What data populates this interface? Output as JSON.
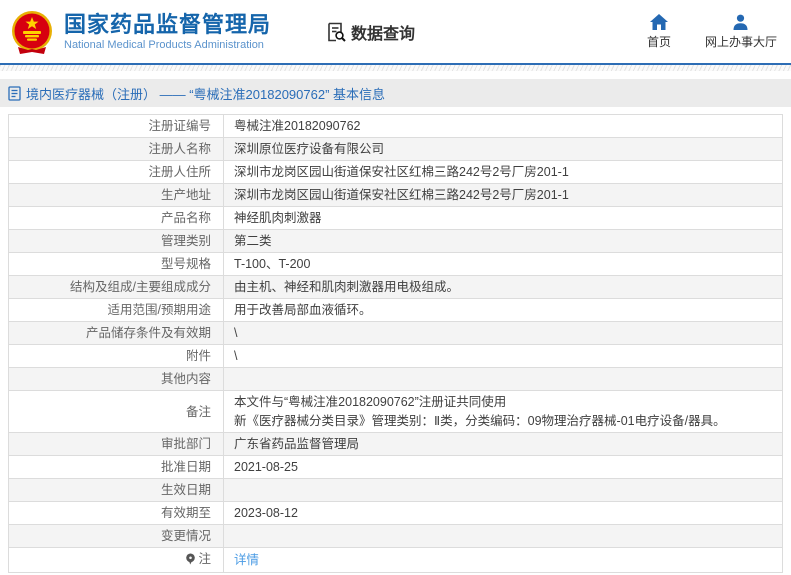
{
  "header": {
    "title": "国家药品监督管理局",
    "subtitle": "National Medical Products Administration",
    "nav_query_label": "数据查询",
    "nav_home_label": "首页",
    "nav_hall_label": "网上办事大厅"
  },
  "breadcrumb": {
    "text": "境内医疗器械（注册） —— “粤械注准20182090762” 基本信息"
  },
  "colors": {
    "brand_blue": "#1565ab",
    "accent_blue": "#2d6db5",
    "link_blue": "#4a9be4",
    "row_alt_gray": "#f4f4f4"
  },
  "table": {
    "rows": [
      {
        "label": "注册证编号",
        "value": "粤械注准20182090762"
      },
      {
        "label": "注册人名称",
        "value": "深圳原位医疗设备有限公司"
      },
      {
        "label": "注册人住所",
        "value": "深圳市龙岗区园山街道保安社区红棉三路242号2号厂房201-1"
      },
      {
        "label": "生产地址",
        "value": "深圳市龙岗区园山街道保安社区红棉三路242号2号厂房201-1"
      },
      {
        "label": "产品名称",
        "value": "神经肌肉刺激器"
      },
      {
        "label": "管理类别",
        "value": "第二类"
      },
      {
        "label": "型号规格",
        "value": "T-100、T-200"
      },
      {
        "label": "结构及组成/主要组成成分",
        "value": "由主机、神经和肌肉刺激器用电极组成。"
      },
      {
        "label": "适用范围/预期用途",
        "value": "用于改善局部血液循环。"
      },
      {
        "label": "产品储存条件及有效期",
        "value": "\\"
      },
      {
        "label": "附件",
        "value": "\\"
      },
      {
        "label": "其他内容",
        "value": ""
      },
      {
        "label": "备注",
        "value_lines": [
          "本文件与“粤械注准20182090762”注册证共同使用",
          "新《医疗器械分类目录》管理类别：Ⅱ类，分类编码：09物理治疗器械-01电疗设备/器具。"
        ]
      },
      {
        "label": "审批部门",
        "value": "广东省药品监督管理局"
      },
      {
        "label": "批准日期",
        "value": "2021-08-25"
      },
      {
        "label": "生效日期",
        "value": ""
      },
      {
        "label": "有效期至",
        "value": "2023-08-12"
      },
      {
        "label": "变更情况",
        "value": ""
      },
      {
        "label": "注",
        "label_icon": "note-balloon-icon",
        "link": "详情"
      }
    ]
  }
}
